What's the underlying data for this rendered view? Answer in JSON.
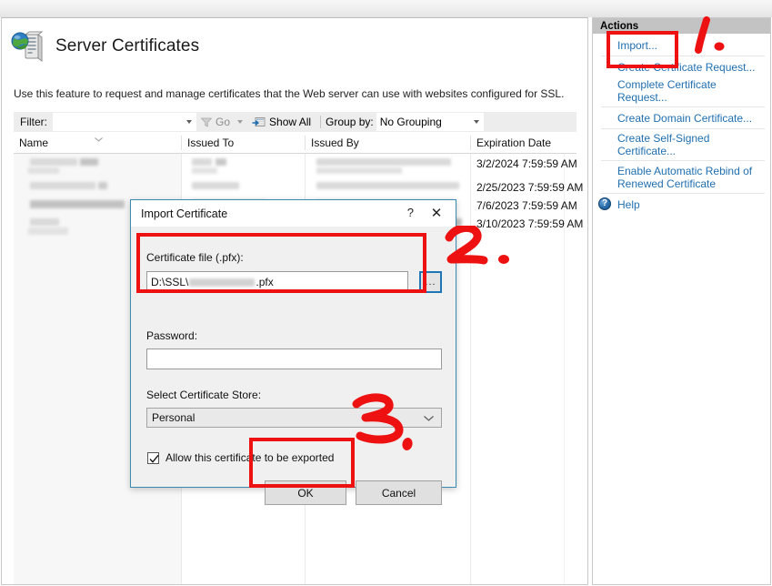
{
  "page": {
    "title": "Server Certificates",
    "icon": "server-certificate-icon",
    "description": "Use this feature to request and manage certificates that the Web server can use with websites configured for SSL."
  },
  "toolbar": {
    "filter_label": "Filter:",
    "filter_value": "",
    "filter_placeholder": "",
    "go_label": "Go",
    "show_all_label": "Show All",
    "group_by_label": "Group by:",
    "group_by_value": "No Grouping"
  },
  "list": {
    "columns": [
      {
        "label": "Name",
        "sorted": true
      },
      {
        "label": "Issued To"
      },
      {
        "label": "Issued By"
      },
      {
        "label": "Expiration Date"
      }
    ],
    "rows": [
      {
        "name": "",
        "issued_to": "",
        "issued_by": "",
        "expiration": "3/2/2024 7:59:59 AM"
      },
      {
        "name": "",
        "issued_to": "",
        "issued_by": "",
        "expiration": "2/25/2023 7:59:59 AM"
      },
      {
        "name": "",
        "issued_to": "",
        "issued_by": "",
        "expiration": "7/6/2023 7:59:59 AM"
      },
      {
        "name": "",
        "issued_to": "",
        "issued_by": "",
        "expiration": "3/10/2023 7:59:59 AM"
      }
    ]
  },
  "actions": {
    "title": "Actions",
    "items": [
      {
        "label": "Import...",
        "name": "import"
      },
      {
        "label": "Create Certificate Request...",
        "name": "create-certificate-request"
      },
      {
        "label": "Complete Certificate Request...",
        "name": "complete-certificate-request"
      },
      {
        "label": "Create Domain Certificate...",
        "name": "create-domain-certificate"
      },
      {
        "label": "Create Self-Signed Certificate...",
        "name": "create-self-signed-certificate"
      },
      {
        "label": "Enable Automatic Rebind of Renewed Certificate",
        "name": "enable-automatic-rebind"
      }
    ],
    "help_label": "Help"
  },
  "dialog": {
    "title": "Import Certificate",
    "help_glyph": "?",
    "close_glyph": "✕",
    "file_label": "Certificate file (.pfx):",
    "file_value_prefix": "D:\\SSL\\",
    "file_value_suffix": ".pfx",
    "browse_label": "...",
    "password_label": "Password:",
    "password_value": "",
    "store_label": "Select Certificate Store:",
    "store_value": "Personal",
    "export_checkbox_label": "Allow this certificate to be exported",
    "export_checkbox_checked": true,
    "ok_label": "OK",
    "cancel_label": "Cancel"
  },
  "annotations": {
    "accent_color": "#ee1111",
    "steps": [
      {
        "label": "1.",
        "target": "import-action"
      },
      {
        "label": "2.",
        "target": "certificate-file-field"
      },
      {
        "label": "3.",
        "target": "ok-button"
      }
    ]
  }
}
